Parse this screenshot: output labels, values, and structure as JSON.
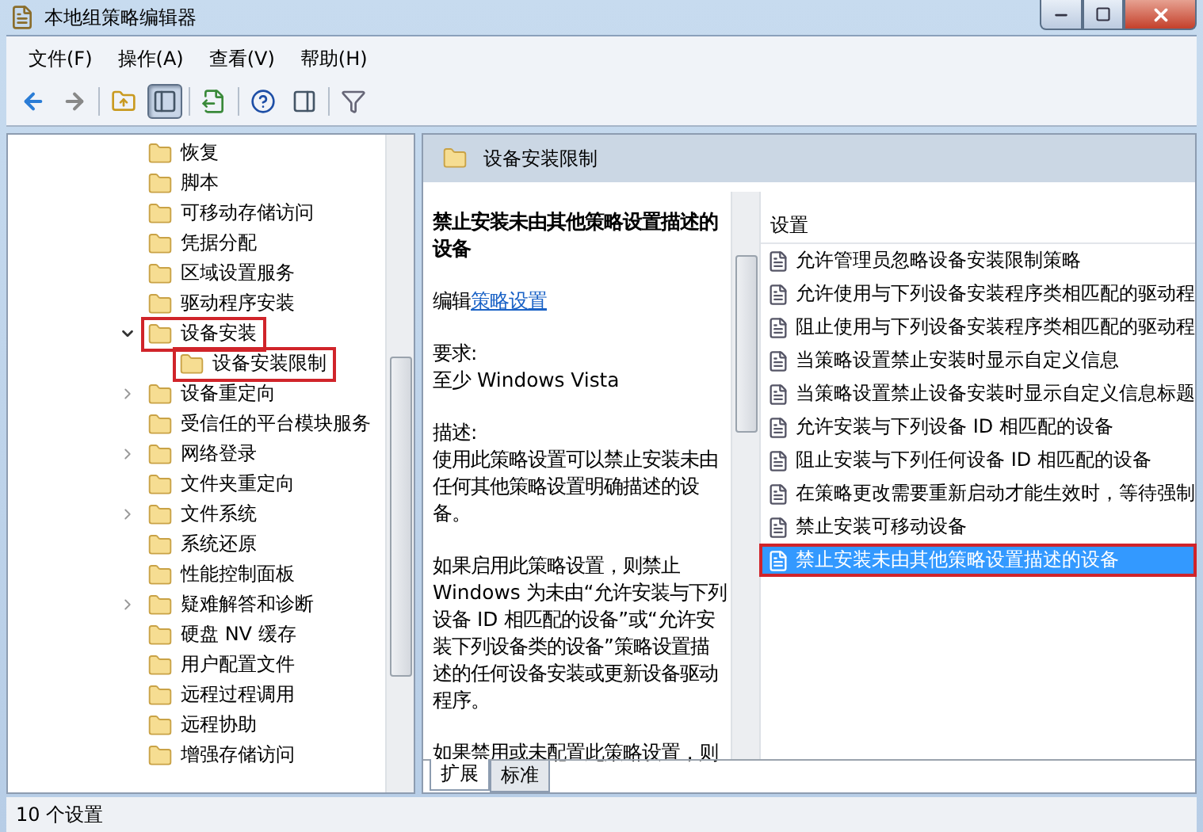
{
  "window": {
    "title": "本地组策略编辑器"
  },
  "menu": [
    "文件(F)",
    "操作(A)",
    "查看(V)",
    "帮助(H)"
  ],
  "toolbar": [
    [
      {
        "kind": "back",
        "pressed": false
      },
      {
        "kind": "forward",
        "pressed": false
      }
    ],
    [
      {
        "kind": "up",
        "pressed": false
      },
      {
        "kind": "tree",
        "pressed": true
      }
    ],
    [
      {
        "kind": "export",
        "pressed": false
      }
    ],
    [
      {
        "kind": "help",
        "pressed": false
      },
      {
        "kind": "pane",
        "pressed": false
      }
    ],
    [
      {
        "kind": "filter",
        "pressed": false
      }
    ]
  ],
  "tree": [
    {
      "label": "恢复",
      "highlighted": false
    },
    {
      "label": "脚本",
      "highlighted": false
    },
    {
      "label": "可移动存储访问",
      "highlighted": false
    },
    {
      "label": "凭据分配",
      "highlighted": false
    },
    {
      "label": "区域设置服务",
      "highlighted": false
    },
    {
      "label": "驱动程序安装",
      "highlighted": false
    },
    {
      "label": "设备安装",
      "expanded": true,
      "highlighted": true,
      "children": [
        {
          "label": "设备安装限制",
          "highlighted": true
        }
      ]
    },
    {
      "label": "设备重定向",
      "expanded": false,
      "highlighted": false
    },
    {
      "label": "受信任的平台模块服务",
      "highlighted": false
    },
    {
      "label": "网络登录",
      "expanded": false,
      "highlighted": false
    },
    {
      "label": "文件夹重定向",
      "highlighted": false
    },
    {
      "label": "文件系统",
      "expanded": false,
      "highlighted": false
    },
    {
      "label": "系统还原",
      "highlighted": false
    },
    {
      "label": "性能控制面板",
      "highlighted": false
    },
    {
      "label": "疑难解答和诊断",
      "expanded": false,
      "highlighted": false
    },
    {
      "label": "硬盘 NV 缓存",
      "highlighted": false
    },
    {
      "label": "用户配置文件",
      "highlighted": false
    },
    {
      "label": "远程过程调用",
      "highlighted": false
    },
    {
      "label": "远程协助",
      "highlighted": false
    },
    {
      "label": "增强存储访问",
      "highlighted": false
    }
  ],
  "details": {
    "header": "设备安装限制",
    "title": "禁止安装未由其他策略设置描述的设备",
    "edit_prefix": "编辑",
    "edit_link": "策略设置",
    "requirement_label": "要求:",
    "requirement": "至少 Windows Vista",
    "description_label": "描述:",
    "paragraphs": [
      "使用此策略设置可以禁止安装未由任何其他策略设置明确描述的设备。",
      "如果启用此策略设置，则禁止 Windows 为未由“允许安装与下列设备 ID 相匹配的设备”或“允许安装下列设备类的设备”策略设置描述的任何设备安装或更新设备驱动程序。",
      "如果禁用或未配置此策略设置，则"
    ]
  },
  "list": {
    "column": "设置",
    "rows": [
      {
        "label": "允许管理员忽略设备安装限制策略",
        "selected": false,
        "highlighted": false
      },
      {
        "label": "允许使用与下列设备安装程序类相匹配的驱动程",
        "selected": false,
        "highlighted": false
      },
      {
        "label": "阻止使用与下列设备安装程序类相匹配的驱动程",
        "selected": false,
        "highlighted": false
      },
      {
        "label": "当策略设置禁止安装时显示自定义信息",
        "selected": false,
        "highlighted": false
      },
      {
        "label": "当策略设置禁止设备安装时显示自定义信息标题",
        "selected": false,
        "highlighted": false
      },
      {
        "label": "允许安装与下列设备 ID 相匹配的设备",
        "selected": false,
        "highlighted": false
      },
      {
        "label": "阻止安装与下列任何设备 ID 相匹配的设备",
        "selected": false,
        "highlighted": false
      },
      {
        "label": "在策略更改需要重新启动才能生效时，等待强制",
        "selected": false,
        "highlighted": false
      },
      {
        "label": "禁止安装可移动设备",
        "selected": false,
        "highlighted": false
      },
      {
        "label": "禁止安装未由其他策略设置描述的设备",
        "selected": true,
        "highlighted": true
      }
    ]
  },
  "tabs": [
    {
      "label": "扩展",
      "selected": true
    },
    {
      "label": "标准",
      "selected": false
    }
  ],
  "status_bar": "10 个设置"
}
